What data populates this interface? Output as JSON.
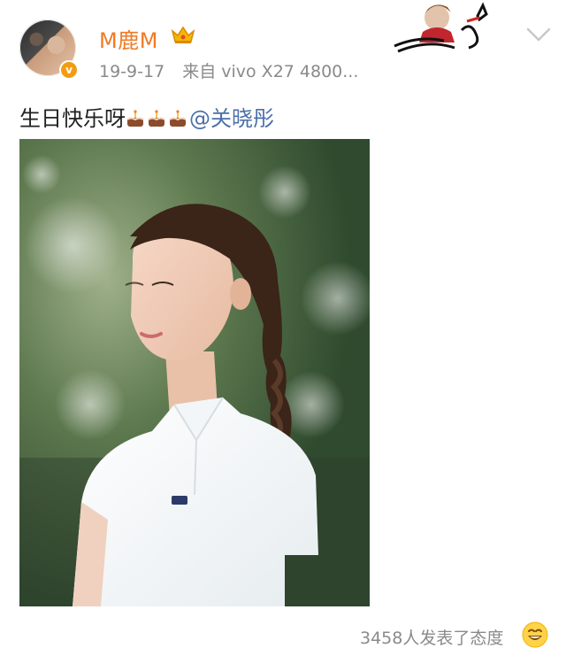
{
  "post": {
    "username": "M鹿M",
    "timestamp": "19-9-17",
    "source": "来自 vivo X27 4800...",
    "text_prefix": "生日快乐呀",
    "mention": "@关晓彤",
    "emoji_count": 3,
    "reaction_summary": "3458人发表了态度"
  },
  "icons": {
    "verified": "verified-badge-icon",
    "crown": "vip-crown-icon",
    "cake": "birthday-cake-emoji-icon",
    "chevron": "chevron-down-icon",
    "smile": "grinning-face-emoji-icon"
  },
  "colors": {
    "username": "#f07a22",
    "mention": "#4b6fa8",
    "meta": "#8a8a8a",
    "verified": "#f39c12"
  }
}
